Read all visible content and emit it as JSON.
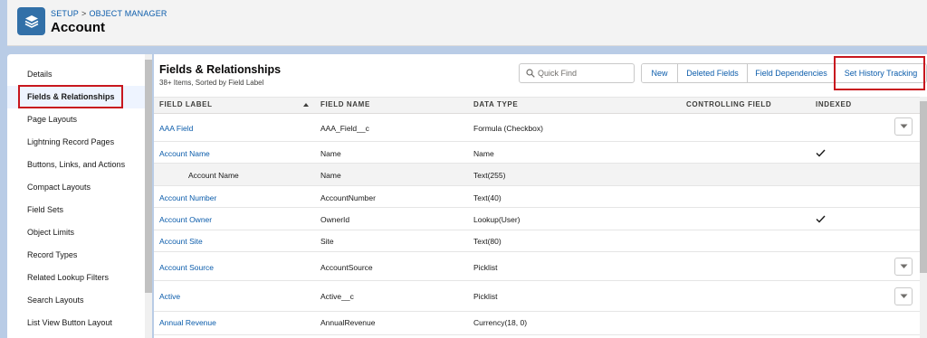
{
  "header": {
    "breadcrumb": [
      "SETUP",
      "OBJECT MANAGER"
    ],
    "breadcrumb_sep": ">",
    "title": "Account",
    "icon": "layers-icon"
  },
  "sidebar": {
    "items": [
      {
        "label": "Details"
      },
      {
        "label": "Fields & Relationships",
        "active": true
      },
      {
        "label": "Page Layouts"
      },
      {
        "label": "Lightning Record Pages"
      },
      {
        "label": "Buttons, Links, and Actions"
      },
      {
        "label": "Compact Layouts"
      },
      {
        "label": "Field Sets"
      },
      {
        "label": "Object Limits"
      },
      {
        "label": "Record Types"
      },
      {
        "label": "Related Lookup Filters"
      },
      {
        "label": "Search Layouts"
      },
      {
        "label": "List View Button Layout"
      }
    ]
  },
  "main": {
    "title": "Fields & Relationships",
    "subtitle": "38+ Items, Sorted by Field Label",
    "quick_find_placeholder": "Quick Find",
    "buttons": [
      "New",
      "Deleted Fields",
      "Field Dependencies",
      "Set History Tracking"
    ],
    "columns": [
      "FIELD LABEL",
      "FIELD NAME",
      "DATA TYPE",
      "CONTROLLING FIELD",
      "INDEXED"
    ],
    "rows": [
      {
        "label": "AAA Field",
        "name": "AAA_Field__c",
        "type": "Formula (Checkbox)",
        "controlling": "",
        "indexed": false,
        "menu": true
      },
      {
        "label": "Account Name",
        "name": "Name",
        "type": "Name",
        "controlling": "",
        "indexed": true,
        "menu": false
      },
      {
        "label": "Account Name",
        "name": "Name",
        "type": "Text(255)",
        "controlling": "",
        "indexed": false,
        "menu": false,
        "sub": true
      },
      {
        "label": "Account Number",
        "name": "AccountNumber",
        "type": "Text(40)",
        "controlling": "",
        "indexed": false,
        "menu": false
      },
      {
        "label": "Account Owner",
        "name": "OwnerId",
        "type": "Lookup(User)",
        "controlling": "",
        "indexed": true,
        "menu": false
      },
      {
        "label": "Account Site",
        "name": "Site",
        "type": "Text(80)",
        "controlling": "",
        "indexed": false,
        "menu": false
      },
      {
        "label": "Account Source",
        "name": "AccountSource",
        "type": "Picklist",
        "controlling": "",
        "indexed": false,
        "menu": true
      },
      {
        "label": "Active",
        "name": "Active__c",
        "type": "Picklist",
        "controlling": "",
        "indexed": false,
        "menu": true
      },
      {
        "label": "Annual Revenue",
        "name": "AnnualRevenue",
        "type": "Currency(18, 0)",
        "controlling": "",
        "indexed": false,
        "menu": false
      }
    ]
  },
  "colors": {
    "accent": "#0b5cab",
    "highlight": "#c8171e",
    "app_icon": "#3270a8"
  }
}
